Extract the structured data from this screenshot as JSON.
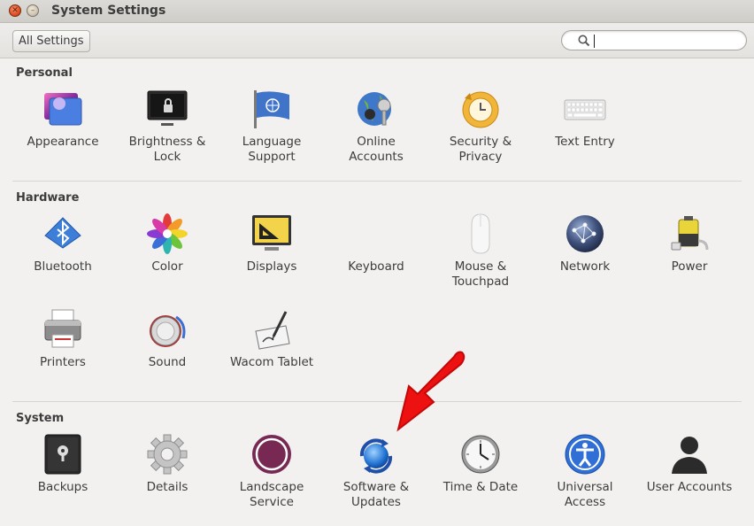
{
  "window": {
    "title": "System Settings"
  },
  "toolbar": {
    "all_settings_label": "All Settings",
    "search_value": ""
  },
  "sections": [
    {
      "title": "Personal",
      "items": [
        {
          "label": "Appearance",
          "icon": "appearance-icon"
        },
        {
          "label": "Brightness &\nLock",
          "icon": "brightness-lock-icon"
        },
        {
          "label": "Language\nSupport",
          "icon": "language-support-icon"
        },
        {
          "label": "Online\nAccounts",
          "icon": "online-accounts-icon"
        },
        {
          "label": "Security &\nPrivacy",
          "icon": "security-privacy-icon"
        },
        {
          "label": "Text Entry",
          "icon": "keyboard-icon"
        }
      ]
    },
    {
      "title": "Hardware",
      "items": [
        {
          "label": "Bluetooth",
          "icon": "bluetooth-icon"
        },
        {
          "label": "Color",
          "icon": "color-icon"
        },
        {
          "label": "Displays",
          "icon": "displays-icon"
        },
        {
          "label": "Keyboard",
          "icon": "keyboard-icon"
        },
        {
          "label": "Mouse &\nTouchpad",
          "icon": "mouse-icon"
        },
        {
          "label": "Network",
          "icon": "network-icon"
        },
        {
          "label": "Power",
          "icon": "power-icon"
        },
        {
          "label": "Printers",
          "icon": "printer-icon"
        },
        {
          "label": "Sound",
          "icon": "sound-icon"
        },
        {
          "label": "Wacom Tablet",
          "icon": "wacom-tablet-icon"
        }
      ]
    },
    {
      "title": "System",
      "items": [
        {
          "label": "Backups",
          "icon": "backups-icon"
        },
        {
          "label": "Details",
          "icon": "gear-icon"
        },
        {
          "label": "Landscape\nService",
          "icon": "landscape-icon"
        },
        {
          "label": "Software &\nUpdates",
          "icon": "software-updates-icon"
        },
        {
          "label": "Time & Date",
          "icon": "clock-icon"
        },
        {
          "label": "Universal\nAccess",
          "icon": "universal-access-icon"
        },
        {
          "label": "User Accounts",
          "icon": "user-accounts-icon"
        }
      ]
    }
  ],
  "colors": {
    "annotation_arrow": "#ee1111",
    "accent_orange": "#e2522a"
  }
}
